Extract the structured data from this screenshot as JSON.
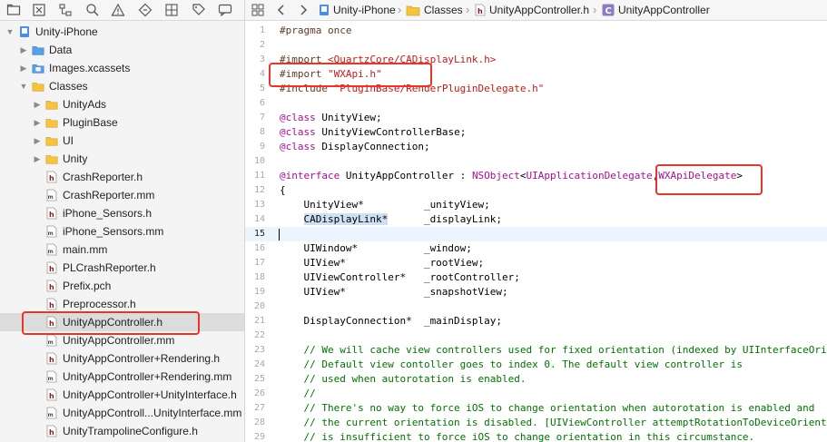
{
  "navigator": {
    "toolbar_icons": [
      "folder-icon",
      "close-square-icon",
      "hierarchy-icon",
      "search-icon",
      "warning-icon",
      "test-diamond-icon",
      "grid-icon",
      "tag-icon",
      "chat-icon"
    ],
    "tree": [
      {
        "label": "Unity-iPhone",
        "icon": "project-icon",
        "depth": 0,
        "expanded": true
      },
      {
        "label": "Data",
        "icon": "blue-folder-icon",
        "depth": 1,
        "expanded": false
      },
      {
        "label": "Images.xcassets",
        "icon": "asset-catalog-icon",
        "depth": 1,
        "expanded": false
      },
      {
        "label": "Classes",
        "icon": "folder-icon",
        "depth": 1,
        "expanded": true
      },
      {
        "label": "UnityAds",
        "icon": "folder-icon",
        "depth": 2,
        "expanded": false
      },
      {
        "label": "PluginBase",
        "icon": "folder-icon",
        "depth": 2,
        "expanded": false
      },
      {
        "label": "UI",
        "icon": "folder-icon",
        "depth": 2,
        "expanded": false
      },
      {
        "label": "Unity",
        "icon": "folder-icon",
        "depth": 2,
        "expanded": false
      },
      {
        "label": "CrashReporter.h",
        "icon": "header-file-icon",
        "depth": 2
      },
      {
        "label": "CrashReporter.mm",
        "icon": "source-file-icon",
        "depth": 2
      },
      {
        "label": "iPhone_Sensors.h",
        "icon": "header-file-icon",
        "depth": 2
      },
      {
        "label": "iPhone_Sensors.mm",
        "icon": "source-file-icon",
        "depth": 2
      },
      {
        "label": "main.mm",
        "icon": "source-file-icon",
        "depth": 2
      },
      {
        "label": "PLCrashReporter.h",
        "icon": "header-file-icon",
        "depth": 2
      },
      {
        "label": "Prefix.pch",
        "icon": "header-file-icon",
        "depth": 2
      },
      {
        "label": "Preprocessor.h",
        "icon": "header-file-icon",
        "depth": 2
      },
      {
        "label": "UnityAppController.h",
        "icon": "header-file-icon",
        "depth": 2,
        "selected": true
      },
      {
        "label": "UnityAppController.mm",
        "icon": "source-file-icon",
        "depth": 2
      },
      {
        "label": "UnityAppController+Rendering.h",
        "icon": "header-file-icon",
        "depth": 2
      },
      {
        "label": "UnityAppController+Rendering.mm",
        "icon": "source-file-icon",
        "depth": 2
      },
      {
        "label": "UnityAppController+UnityInterface.h",
        "icon": "header-file-icon",
        "depth": 2
      },
      {
        "label": "UnityAppControll...UnityInterface.mm",
        "icon": "source-file-icon",
        "depth": 2
      },
      {
        "label": "UnityTrampolineConfigure.h",
        "icon": "header-file-icon",
        "depth": 2
      }
    ]
  },
  "jumpbar": {
    "items": [
      {
        "label": "Unity-iPhone",
        "icon": "project-icon"
      },
      {
        "label": "Classes",
        "icon": "folder-icon"
      },
      {
        "label": "UnityAppController.h",
        "icon": "header-file-icon"
      },
      {
        "label": "UnityAppController",
        "icon": "class-c-icon"
      }
    ]
  },
  "editor": {
    "current_line": 15,
    "lines": [
      {
        "n": "1",
        "tokens": [
          {
            "t": "#pragma once",
            "c": "t-pre"
          }
        ]
      },
      {
        "n": "2",
        "tokens": []
      },
      {
        "n": "3",
        "tokens": [
          {
            "t": "#import ",
            "c": "t-pre"
          },
          {
            "t": "<QuartzCore/CADisplayLink.h>",
            "c": "t-str"
          }
        ]
      },
      {
        "n": "4",
        "tokens": [
          {
            "t": "#import ",
            "c": "t-pre"
          },
          {
            "t": "\"WXApi.h\"",
            "c": "t-str"
          }
        ]
      },
      {
        "n": "5",
        "tokens": [
          {
            "t": "#include ",
            "c": "t-pre"
          },
          {
            "t": "\"PluginBase/RenderPluginDelegate.h\"",
            "c": "t-str"
          }
        ]
      },
      {
        "n": "6",
        "tokens": []
      },
      {
        "n": "7",
        "tokens": [
          {
            "t": "@class",
            "c": "t-kw"
          },
          {
            "t": " UnityView;",
            "c": ""
          }
        ]
      },
      {
        "n": "8",
        "tokens": [
          {
            "t": "@class",
            "c": "t-kw"
          },
          {
            "t": " UnityViewControllerBase;",
            "c": ""
          }
        ]
      },
      {
        "n": "9",
        "tokens": [
          {
            "t": "@class",
            "c": "t-kw"
          },
          {
            "t": " DisplayConnection;",
            "c": ""
          }
        ]
      },
      {
        "n": "10",
        "tokens": []
      },
      {
        "n": "11",
        "tokens": [
          {
            "t": "@interface",
            "c": "t-kw"
          },
          {
            "t": " UnityAppController : ",
            "c": ""
          },
          {
            "t": "NSObject",
            "c": "t-kw"
          },
          {
            "t": "<",
            "c": ""
          },
          {
            "t": "UIApplicationDelegate",
            "c": "t-kw"
          },
          {
            "t": ",",
            "c": ""
          },
          {
            "t": "WXApiDelegate",
            "c": "t-kw"
          },
          {
            "t": ">",
            "c": ""
          }
        ]
      },
      {
        "n": "12",
        "tokens": [
          {
            "t": "{",
            "c": ""
          }
        ]
      },
      {
        "n": "13",
        "tokens": [
          {
            "t": "    UnityView*          _unityView;",
            "c": ""
          }
        ]
      },
      {
        "n": "14",
        "tokens": [
          {
            "t": "    ",
            "c": ""
          },
          {
            "t": "CADisplayLink*",
            "c": "t-hl"
          },
          {
            "t": "      _displayLink;",
            "c": ""
          }
        ]
      },
      {
        "n": "15",
        "tokens": []
      },
      {
        "n": "16",
        "tokens": [
          {
            "t": "    UIWindow*           _window;",
            "c": ""
          }
        ]
      },
      {
        "n": "17",
        "tokens": [
          {
            "t": "    UIView*             _rootView;",
            "c": ""
          }
        ]
      },
      {
        "n": "18",
        "tokens": [
          {
            "t": "    UIViewController*   _rootController;",
            "c": ""
          }
        ]
      },
      {
        "n": "19",
        "tokens": [
          {
            "t": "    UIView*             _snapshotView;",
            "c": ""
          }
        ]
      },
      {
        "n": "20",
        "tokens": []
      },
      {
        "n": "21",
        "tokens": [
          {
            "t": "    DisplayConnection*  _mainDisplay;",
            "c": ""
          }
        ]
      },
      {
        "n": "22",
        "tokens": []
      },
      {
        "n": "23",
        "tokens": [
          {
            "t": "    // We will cache view controllers used for fixed orientation (indexed by UIInterfaceOrientation).",
            "c": "t-com"
          }
        ]
      },
      {
        "n": "24",
        "tokens": [
          {
            "t": "    // Default view contoller goes to index 0. The default view controller is",
            "c": "t-com"
          }
        ]
      },
      {
        "n": "25",
        "tokens": [
          {
            "t": "    // used when autorotation is enabled.",
            "c": "t-com"
          }
        ]
      },
      {
        "n": "26",
        "tokens": [
          {
            "t": "    //",
            "c": "t-com"
          }
        ]
      },
      {
        "n": "27",
        "tokens": [
          {
            "t": "    // There's no way to force iOS to change orientation when autorotation is enabled and",
            "c": "t-com"
          }
        ]
      },
      {
        "n": "28",
        "tokens": [
          {
            "t": "    // the current orientation is disabled. [UIViewController attemptRotationToDeviceOrientation]",
            "c": "t-com"
          }
        ]
      },
      {
        "n": "29",
        "tokens": [
          {
            "t": "    // is insufficient to force iOS to change orientation in this circumstance.",
            "c": "t-com"
          }
        ]
      }
    ]
  },
  "colors": {
    "annotation": "#e8352a",
    "selection": "#dcdcdc",
    "current_line": "#ecf5ff"
  }
}
